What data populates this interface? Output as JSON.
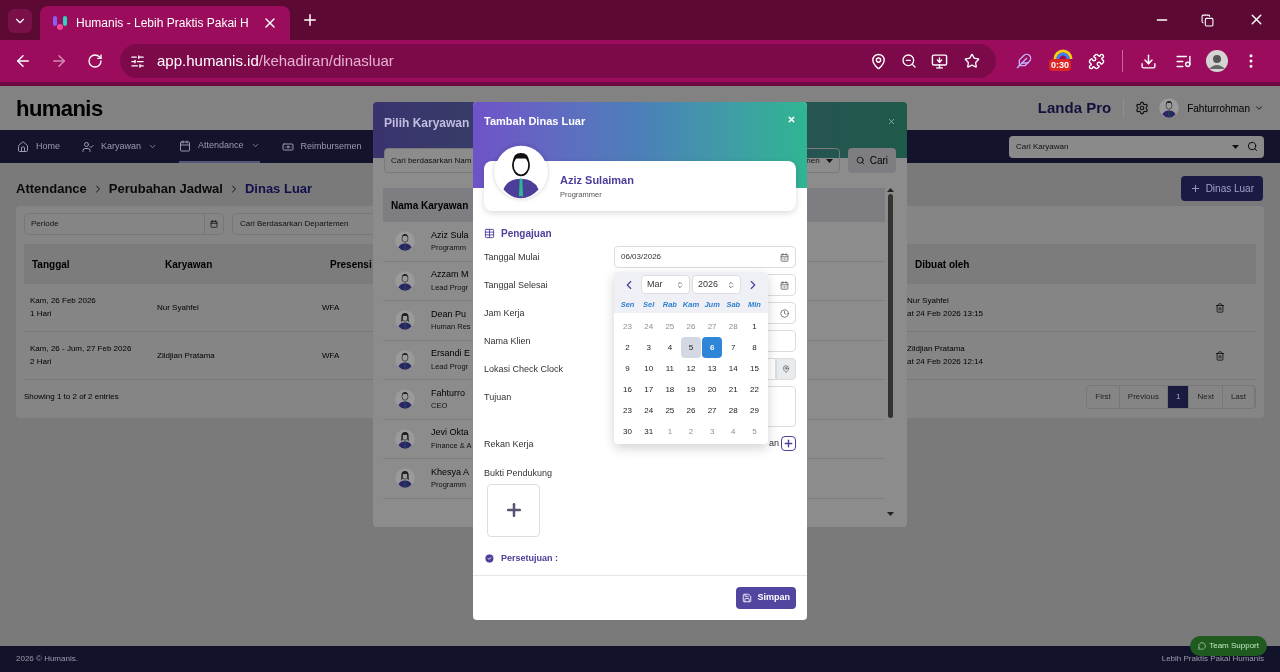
{
  "browser": {
    "tab_title": "Humanis - Lebih Praktis Pakai H",
    "url_host": "app.humanis.id",
    "url_path": "/kehadiran/dinasluar",
    "extension_badge": "0:30"
  },
  "header": {
    "logo": "humanis",
    "company": "Landa Pro",
    "user": "Fahturrohman"
  },
  "nav": {
    "items": [
      {
        "label": "Home",
        "selected": false,
        "dropdown": false
      },
      {
        "label": "Karyawan",
        "selected": false,
        "dropdown": true
      },
      {
        "label": "Attendance",
        "selected": true,
        "dropdown": true
      },
      {
        "label": "Reimbursemen",
        "selected": false,
        "dropdown": false
      }
    ],
    "search_placeholder": "Cari Karyawan"
  },
  "breadcrumb": [
    "Attendance",
    "Perubahan Jadwal",
    "Dinas Luar"
  ],
  "add_button": "Dinas Luar",
  "filters": {
    "period_placeholder": "Periode",
    "department_placeholder": "Cari Berdasarkan Departemen"
  },
  "table": {
    "columns": [
      "Tanggal",
      "Karyawan",
      "Presensi",
      "Dibuat oleh"
    ],
    "rows": [
      {
        "date": "Kam, 26 Feb 2026",
        "days": "1 Hari",
        "employee": "Nur Syahfei",
        "presence": "WFA",
        "created_by": "Nur Syahfei",
        "created_at": "at 24 Feb 2026 13:15"
      },
      {
        "date": "Kam, 26 - Jum, 27 Feb 2026",
        "days": "2 Hari",
        "employee": "Zildjian Pratama",
        "presence": "WFA",
        "created_by": "Zildjian Pratama",
        "created_at": "at 24 Feb 2026 12:14"
      }
    ]
  },
  "entries": "Showing 1 to 2 of 2 entries",
  "pagination": [
    {
      "label": "First",
      "selected": false
    },
    {
      "label": "Previous",
      "selected": false
    },
    {
      "label": "1",
      "selected": true
    },
    {
      "label": "Next",
      "selected": false
    },
    {
      "label": "Last",
      "selected": false
    }
  ],
  "employee_picker": {
    "title": "Pilih Karyawan",
    "search_placeholder": "Cari berdasarkan Nam",
    "department_placeholder": "nen",
    "search_button": "Cari",
    "column": "Nama Karyawan",
    "employees": [
      {
        "name": "Aziz Sula",
        "role": "Programm",
        "kind": "male"
      },
      {
        "name": "Azzam M",
        "role": "Lead Progr",
        "kind": "male"
      },
      {
        "name": "Dean Pu",
        "role": "Human Res",
        "kind": "female"
      },
      {
        "name": "Ersandi E",
        "role": "Lead Progr",
        "kind": "male"
      },
      {
        "name": "Fahturro",
        "role": "CEO",
        "kind": "male"
      },
      {
        "name": "Jevi Okta",
        "role": "Finance & A",
        "kind": "female"
      },
      {
        "name": "Khesya A",
        "role": "Programm",
        "kind": "female"
      }
    ]
  },
  "form": {
    "title": "Tambah Dinas Luar",
    "employee": {
      "name": "Aziz Sulaiman",
      "role": "Programmer"
    },
    "section": "Pengajuan",
    "fields": [
      {
        "label": "Tanggal Mulai",
        "kind": "date",
        "value": "06/03/2026"
      },
      {
        "label": "Tanggal Selesai",
        "kind": "date"
      },
      {
        "label": "Jam Kerja",
        "kind": "time"
      },
      {
        "label": "Nama Klien",
        "kind": "text"
      },
      {
        "label": "Lokasi Check Clock",
        "kind": "location"
      },
      {
        "label": "Tujuan",
        "kind": "textarea"
      },
      {
        "label": "Rekan Kerja",
        "kind": "add",
        "value": "an"
      },
      {
        "label": "Bukti Pendukung",
        "kind": "upload"
      }
    ],
    "approval": "Persetujuan :",
    "save": "Simpan"
  },
  "datepicker": {
    "month": "Mar",
    "year": "2026",
    "weekdays": [
      "Sen",
      "Sel",
      "Rab",
      "Kam",
      "Jum",
      "Sab",
      "Min"
    ],
    "weeks": [
      [
        {
          "day": "23",
          "outside": true,
          "selected": false,
          "hover": false
        },
        {
          "day": "24",
          "outside": true,
          "selected": false,
          "hover": false
        },
        {
          "day": "25",
          "outside": true,
          "selected": false,
          "hover": false
        },
        {
          "day": "26",
          "outside": true,
          "selected": false,
          "hover": false
        },
        {
          "day": "27",
          "outside": true,
          "selected": false,
          "hover": false
        },
        {
          "day": "28",
          "outside": true,
          "selected": false,
          "hover": false
        },
        {
          "day": "1",
          "outside": false,
          "selected": false,
          "hover": false
        }
      ],
      [
        {
          "day": "2",
          "outside": false,
          "selected": false,
          "hover": false
        },
        {
          "day": "3",
          "outside": false,
          "selected": false,
          "hover": false
        },
        {
          "day": "4",
          "outside": false,
          "selected": false,
          "hover": false
        },
        {
          "day": "5",
          "outside": false,
          "selected": false,
          "hover": true
        },
        {
          "day": "6",
          "outside": false,
          "selected": true,
          "hover": false
        },
        {
          "day": "7",
          "outside": false,
          "selected": false,
          "hover": false
        },
        {
          "day": "8",
          "outside": false,
          "selected": false,
          "hover": false
        }
      ],
      [
        {
          "day": "9",
          "outside": false,
          "selected": false,
          "hover": false
        },
        {
          "day": "10",
          "outside": false,
          "selected": false,
          "hover": false
        },
        {
          "day": "11",
          "outside": false,
          "selected": false,
          "hover": false
        },
        {
          "day": "12",
          "outside": false,
          "selected": false,
          "hover": false
        },
        {
          "day": "13",
          "outside": false,
          "selected": false,
          "hover": false
        },
        {
          "day": "14",
          "outside": false,
          "selected": false,
          "hover": false
        },
        {
          "day": "15",
          "outside": false,
          "selected": false,
          "hover": false
        }
      ],
      [
        {
          "day": "16",
          "outside": false,
          "selected": false,
          "hover": false
        },
        {
          "day": "17",
          "outside": false,
          "selected": false,
          "hover": false
        },
        {
          "day": "18",
          "outside": false,
          "selected": false,
          "hover": false
        },
        {
          "day": "19",
          "outside": false,
          "selected": false,
          "hover": false
        },
        {
          "day": "20",
          "outside": false,
          "selected": false,
          "hover": false
        },
        {
          "day": "21",
          "outside": false,
          "selected": false,
          "hover": false
        },
        {
          "day": "22",
          "outside": false,
          "selected": false,
          "hover": false
        }
      ],
      [
        {
          "day": "23",
          "outside": false,
          "selected": false,
          "hover": false
        },
        {
          "day": "24",
          "outside": false,
          "selected": false,
          "hover": false
        },
        {
          "day": "25",
          "outside": false,
          "selected": false,
          "hover": false
        },
        {
          "day": "26",
          "outside": false,
          "selected": false,
          "hover": false
        },
        {
          "day": "27",
          "outside": false,
          "selected": false,
          "hover": false
        },
        {
          "day": "28",
          "outside": false,
          "selected": false,
          "hover": false
        },
        {
          "day": "29",
          "outside": false,
          "selected": false,
          "hover": false
        }
      ],
      [
        {
          "day": "30",
          "outside": false,
          "selected": false,
          "hover": false
        },
        {
          "day": "31",
          "outside": false,
          "selected": false,
          "hover": false
        },
        {
          "day": "1",
          "outside": true,
          "selected": false,
          "hover": false
        },
        {
          "day": "2",
          "outside": true,
          "selected": false,
          "hover": false
        },
        {
          "day": "3",
          "outside": true,
          "selected": false,
          "hover": false
        },
        {
          "day": "4",
          "outside": true,
          "selected": false,
          "hover": false
        },
        {
          "day": "5",
          "outside": true,
          "selected": false,
          "hover": false
        }
      ]
    ]
  },
  "footer": {
    "copyright": "2026 © Humanis.",
    "tagline": "Lebih Praktis Pakai Humanis",
    "support": "Team Support"
  }
}
